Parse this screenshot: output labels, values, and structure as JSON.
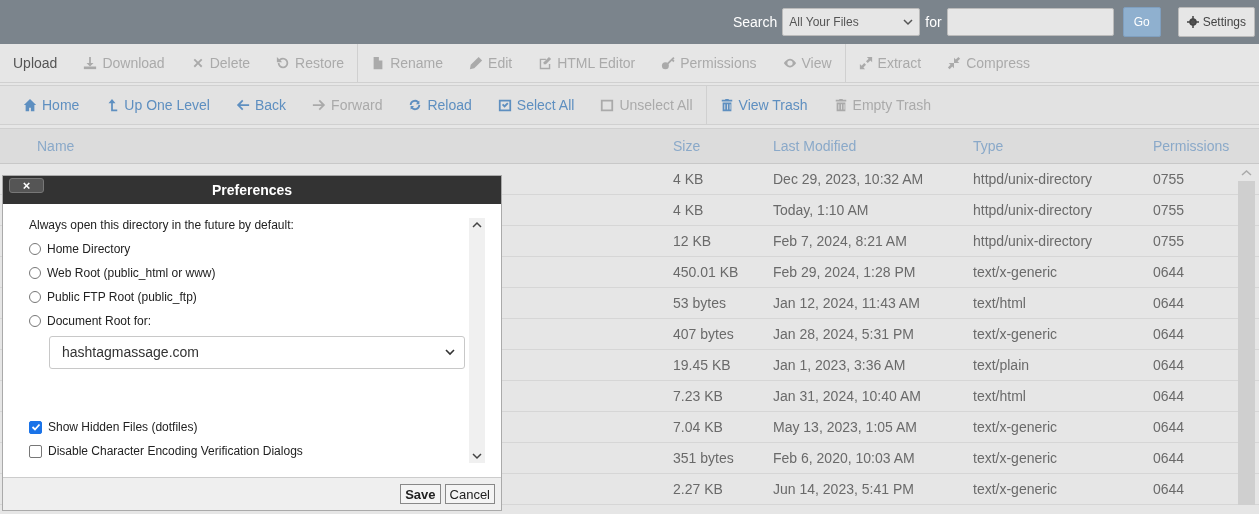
{
  "topbar": {
    "search_label": "Search",
    "scope": "All Your Files",
    "for_label": "for",
    "go": "Go",
    "settings": "Settings"
  },
  "actions": [
    [
      {
        "label": "Upload",
        "disabled": false
      },
      {
        "label": "Download",
        "disabled": true
      },
      {
        "label": "Delete",
        "disabled": true
      },
      {
        "label": "Restore",
        "disabled": true
      }
    ],
    [
      {
        "label": "Rename",
        "disabled": true
      },
      {
        "label": "Edit",
        "disabled": true
      },
      {
        "label": "HTML Editor",
        "disabled": true
      },
      {
        "label": "Permissions",
        "disabled": true
      },
      {
        "label": "View",
        "disabled": true
      }
    ],
    [
      {
        "label": "Extract",
        "disabled": true
      },
      {
        "label": "Compress",
        "disabled": true
      }
    ]
  ],
  "navigation": [
    [
      {
        "label": "Home",
        "disabled": false
      },
      {
        "label": "Up One Level",
        "disabled": false
      },
      {
        "label": "Back",
        "disabled": false
      },
      {
        "label": "Forward",
        "disabled": true
      },
      {
        "label": "Reload",
        "disabled": false
      },
      {
        "label": "Select All",
        "disabled": false
      },
      {
        "label": "Unselect All",
        "disabled": true
      }
    ],
    [
      {
        "label": "View Trash",
        "disabled": false
      },
      {
        "label": "Empty Trash",
        "disabled": true
      }
    ]
  ],
  "table": {
    "columns": [
      "Name",
      "Size",
      "Last Modified",
      "Type",
      "Permissions"
    ],
    "rows": [
      {
        "size": "4 KB",
        "modified": "Dec 29, 2023, 10:32 AM",
        "type": "httpd/unix-directory",
        "permissions": "0755"
      },
      {
        "size": "4 KB",
        "modified": "Today, 1:10 AM",
        "type": "httpd/unix-directory",
        "permissions": "0755"
      },
      {
        "size": "12 KB",
        "modified": "Feb 7, 2024, 8:21 AM",
        "type": "httpd/unix-directory",
        "permissions": "0755"
      },
      {
        "size": "450.01 KB",
        "modified": "Feb 29, 2024, 1:28 PM",
        "type": "text/x-generic",
        "permissions": "0644"
      },
      {
        "size": "53 bytes",
        "modified": "Jan 12, 2024, 11:43 AM",
        "type": "text/html",
        "permissions": "0644"
      },
      {
        "size": "407 bytes",
        "modified": "Jan 28, 2024, 5:31 PM",
        "type": "text/x-generic",
        "permissions": "0644"
      },
      {
        "size": "19.45 KB",
        "modified": "Jan 1, 2023, 3:36 AM",
        "type": "text/plain",
        "permissions": "0644"
      },
      {
        "size": "7.23 KB",
        "modified": "Jan 31, 2024, 10:40 AM",
        "type": "text/html",
        "permissions": "0644"
      },
      {
        "size": "7.04 KB",
        "modified": "May 13, 2023, 1:05 AM",
        "type": "text/x-generic",
        "permissions": "0644"
      },
      {
        "size": "351 bytes",
        "modified": "Feb 6, 2020, 10:03 AM",
        "type": "text/x-generic",
        "permissions": "0644"
      },
      {
        "size": "2.27 KB",
        "modified": "Jun 14, 2023, 5:41 PM",
        "type": "text/x-generic",
        "permissions": "0644"
      }
    ]
  },
  "dialog": {
    "title": "Preferences",
    "close": "×",
    "intro": "Always open this directory in the future by default:",
    "radios": [
      {
        "label": "Home Directory",
        "selected": false
      },
      {
        "label": "Web Root (public_html or www)",
        "selected": false
      },
      {
        "label": "Public FTP Root (public_ftp)",
        "selected": false
      },
      {
        "label": "Document Root for:",
        "selected": false
      }
    ],
    "domain": "hashtagmassage.com",
    "checkboxes": [
      {
        "label": "Show Hidden Files (dotfiles)",
        "checked": true
      },
      {
        "label": "Disable Character Encoding Verification Dialogs",
        "checked": false
      }
    ],
    "buttons": [
      "Save",
      "Cancel"
    ]
  }
}
